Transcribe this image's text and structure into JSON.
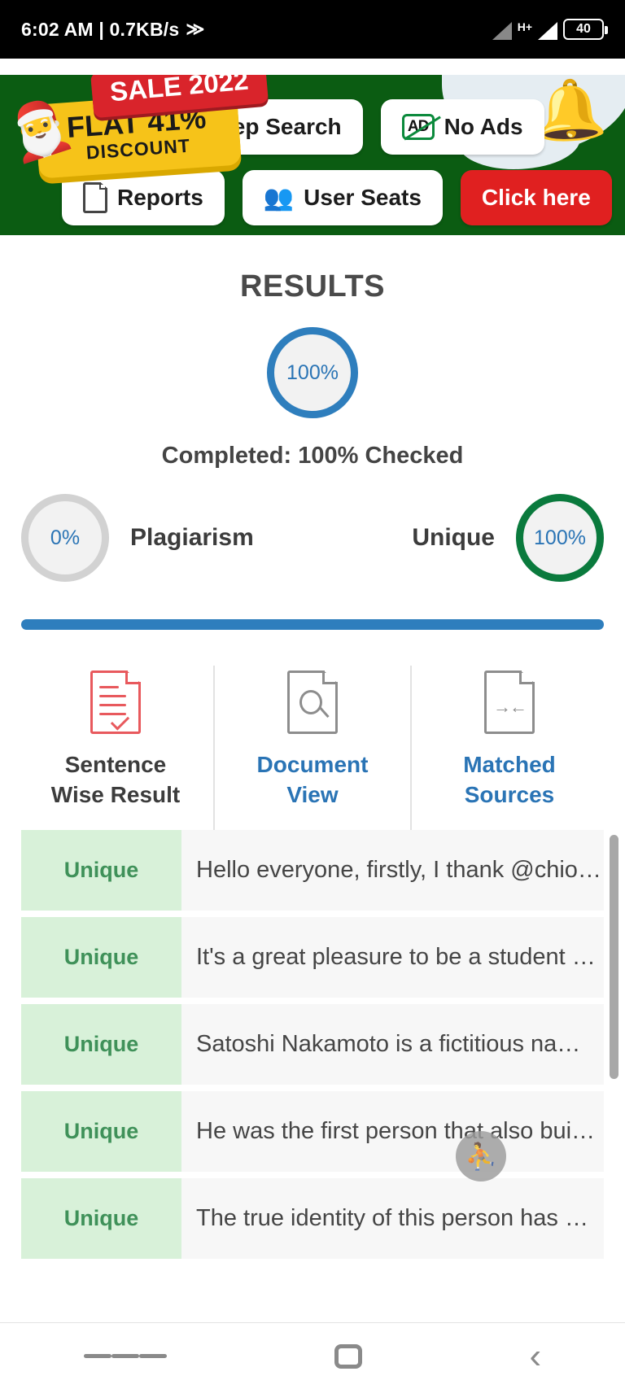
{
  "statusbar": {
    "time_network": "6:02 AM | 0.7KB/s",
    "speed_icon": "double-chevron-icon",
    "network_type": "H+",
    "battery_level": "40"
  },
  "promo": {
    "sale_badge": "SALE 2022",
    "discount_line1": "FLAT 41%",
    "discount_line2": "DISCOUNT",
    "buttons": [
      {
        "label": "Deep Search",
        "icon": "search-icon",
        "style": "white"
      },
      {
        "label": "No Ads",
        "icon": "ad-blocked-icon",
        "style": "white"
      },
      {
        "label": "Reports",
        "icon": "report-icon",
        "style": "white"
      },
      {
        "label": "User Seats",
        "icon": "users-icon",
        "style": "white"
      },
      {
        "label": "Click here",
        "icon": "",
        "style": "red"
      }
    ],
    "decor": {
      "santa_hat": "🎅",
      "bells": "🔔",
      "banner_color": "#0b5c12",
      "accent_red": "#e02020",
      "accent_yellow": "#f6c319"
    }
  },
  "results": {
    "title": "RESULTS",
    "main_percent": "100%",
    "completed_text": "Completed: 100% Checked",
    "plagiarism": {
      "value": "0%",
      "label": "Plagiarism",
      "ring_color": "#d2d2d2"
    },
    "unique": {
      "value": "100%",
      "label": "Unique",
      "ring_color": "#0a7a3d"
    },
    "progress_percent": 100
  },
  "tabs": [
    {
      "label_line1": "Sentence",
      "label_line2": "Wise Result",
      "icon": "document-check-icon",
      "active": true
    },
    {
      "label_line1": "Document",
      "label_line2": "View",
      "icon": "document-search-icon",
      "active": false
    },
    {
      "label_line1": "Matched",
      "label_line2": "Sources",
      "icon": "document-match-icon",
      "active": false
    }
  ],
  "sentences": [
    {
      "status": "Unique",
      "text": "Hello everyone, firstly, I thank @chio…"
    },
    {
      "status": "Unique",
      "text": "It's a great pleasure to be a student …"
    },
    {
      "status": "Unique",
      "text": "Satoshi Nakamoto is a fictitious na…"
    },
    {
      "status": "Unique",
      "text": "He was the first person that also bui…"
    },
    {
      "status": "Unique",
      "text": "The true identity of this person has …"
    }
  ],
  "fab": {
    "icon": "accessibility-icon",
    "glyph": "⛹"
  },
  "navbar": [
    {
      "icon": "menu-icon"
    },
    {
      "icon": "home-icon"
    },
    {
      "icon": "back-icon"
    }
  ]
}
